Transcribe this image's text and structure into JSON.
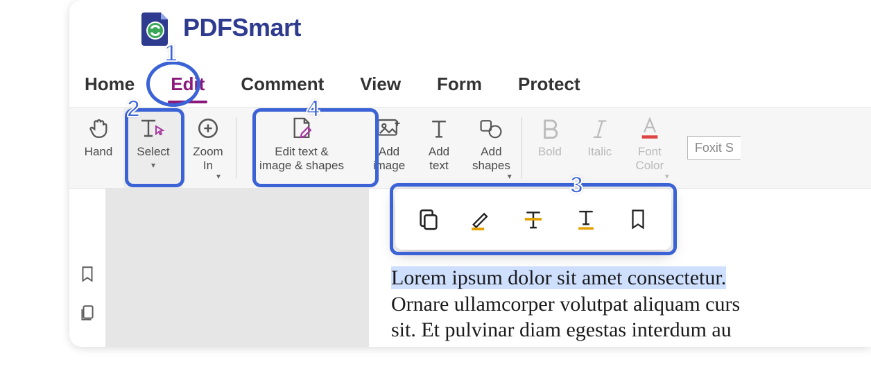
{
  "brand": {
    "bold": "PDF",
    "regular": "Smart"
  },
  "menu": {
    "items": [
      {
        "label": "Home"
      },
      {
        "label": "Edit",
        "active": true
      },
      {
        "label": "Comment"
      },
      {
        "label": "View"
      },
      {
        "label": "Form"
      },
      {
        "label": "Protect"
      }
    ]
  },
  "ribbon": {
    "hand": "Hand",
    "select": "Select",
    "zoom": "Zoom\nIn",
    "edit_tis": "Edit text &\nimage & shapes",
    "add_image": "Add\nimage",
    "add_text": "Add\ntext",
    "add_shapes": "Add\nshapes",
    "bold": "Bold",
    "italic": "Italic",
    "font_color": "Font\nColor",
    "font_family": "Foxit S",
    "caret": "▾"
  },
  "context_toolbar": {
    "icons": [
      "copy-icon",
      "highlight-icon",
      "strikethrough-icon",
      "underline-icon",
      "bookmark-icon"
    ]
  },
  "document": {
    "selected_line": "Lorem ipsum dolor sit amet consectetur.",
    "line2": "Ornare ullamcorper volutpat aliquam curs",
    "line3": "sit. Et pulvinar diam egestas interdum au"
  },
  "callouts": {
    "n1": "1",
    "n2": "2",
    "n3": "3",
    "n4": "4"
  }
}
